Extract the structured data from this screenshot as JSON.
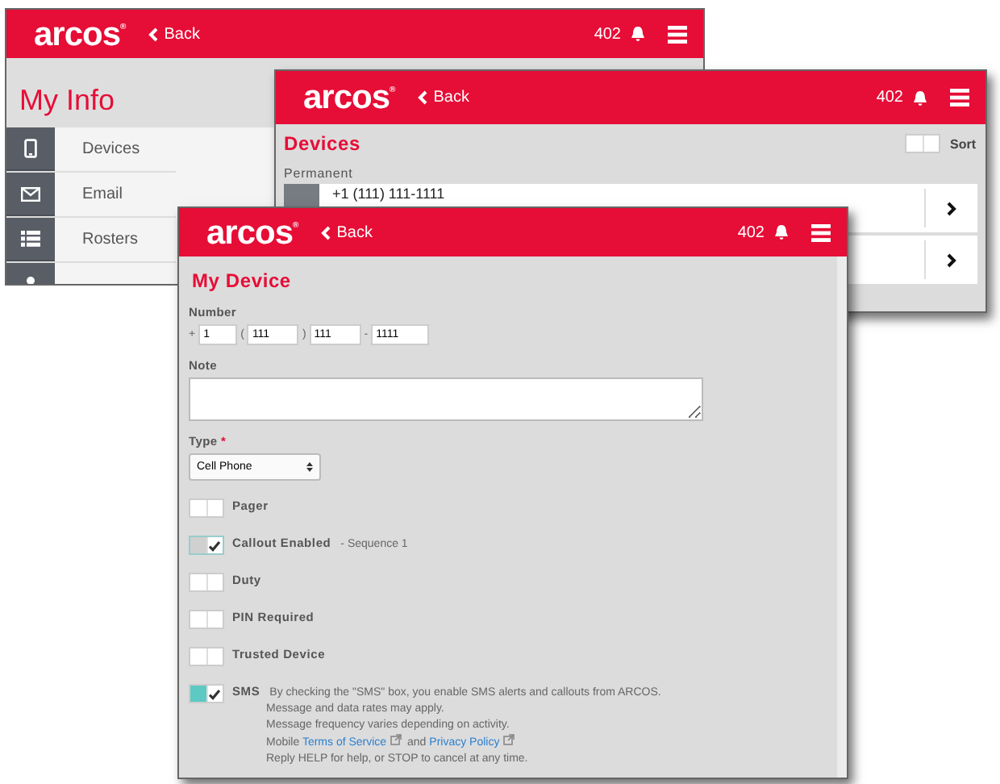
{
  "windows": [
    {
      "kind": "info",
      "header": {
        "logo": "arcos$^{®}$",
        "back": "Back",
        "count": "402"
      },
      "title": "My Info",
      "items": [
        {
          "kind": "device",
          "label": "Devices"
        },
        {
          "kind": "email",
          "label": "Email"
        },
        {
          "kind": "roster",
          "label": "Rosters"
        },
        {
          "kind": "person"
        }
      ]
    },
    {
      "kind": "devices",
      "header": {
        "logo": "arcos$^{®}$",
        "back": "Back",
        "count": "402"
      },
      "title": "Devices",
      "sort": {
        "label": "Sort",
        "on": false
      },
      "section": "Permanent",
      "rows": [
        {
          "kind": "device",
          "number": "+1 (111) 111-1111"
        },
        {
          "kind": "covered"
        }
      ]
    },
    {
      "kind": "form",
      "header": {
        "logo": "arcos$^{®}$",
        "back": "Back",
        "count": "402"
      },
      "title": "My Device",
      "number": {
        "label": "Number",
        "parts": [
          {
            "kind": "sep",
            "text": "+"
          },
          {
            "kind": "input",
            "value": "1"
          },
          {
            "kind": "sep",
            "text": "("
          },
          {
            "kind": "input",
            "value": "111"
          },
          {
            "kind": "sep",
            "text": ")"
          },
          {
            "kind": "input",
            "value": "111"
          },
          {
            "kind": "sep",
            "text": "-"
          },
          {
            "kind": "input",
            "value": "1111"
          }
        ]
      },
      "note": {
        "label": "Note"
      },
      "type": {
        "label": "Type",
        "required": "*",
        "value": "Cell Phone"
      },
      "toggles": [
        {
          "label": "Pager",
          "checked": false,
          "disabled": false
        },
        {
          "label": "Callout Enabled",
          "note": "- Sequence 1",
          "checked": true,
          "disabled": true
        },
        {
          "label": "Duty",
          "checked": false,
          "disabled": false
        },
        {
          "label": "PIN Required",
          "checked": false,
          "disabled": false
        },
        {
          "label": "Trusted Device",
          "checked": false,
          "disabled": false
        },
        {
          "label": "SMS",
          "checked": true,
          "disabled": false,
          "description": [
            {
              "text": "By checking the \"SMS\" box, you enable SMS alerts and callouts from ARCOS."
            },
            {
              "text": "Message and data rates may apply."
            },
            {
              "text": "Message frequency varies depending on activity."
            },
            {
              "parts": [
                {
                  "text": "Mobile "
                },
                {
                  "link": "Terms of Service"
                },
                {
                  "text": " and "
                },
                {
                  "link": "Privacy Policy"
                }
              ]
            },
            {
              "text": "Reply HELP for help, or STOP to cancel at any time."
            }
          ]
        }
      ]
    }
  ]
}
